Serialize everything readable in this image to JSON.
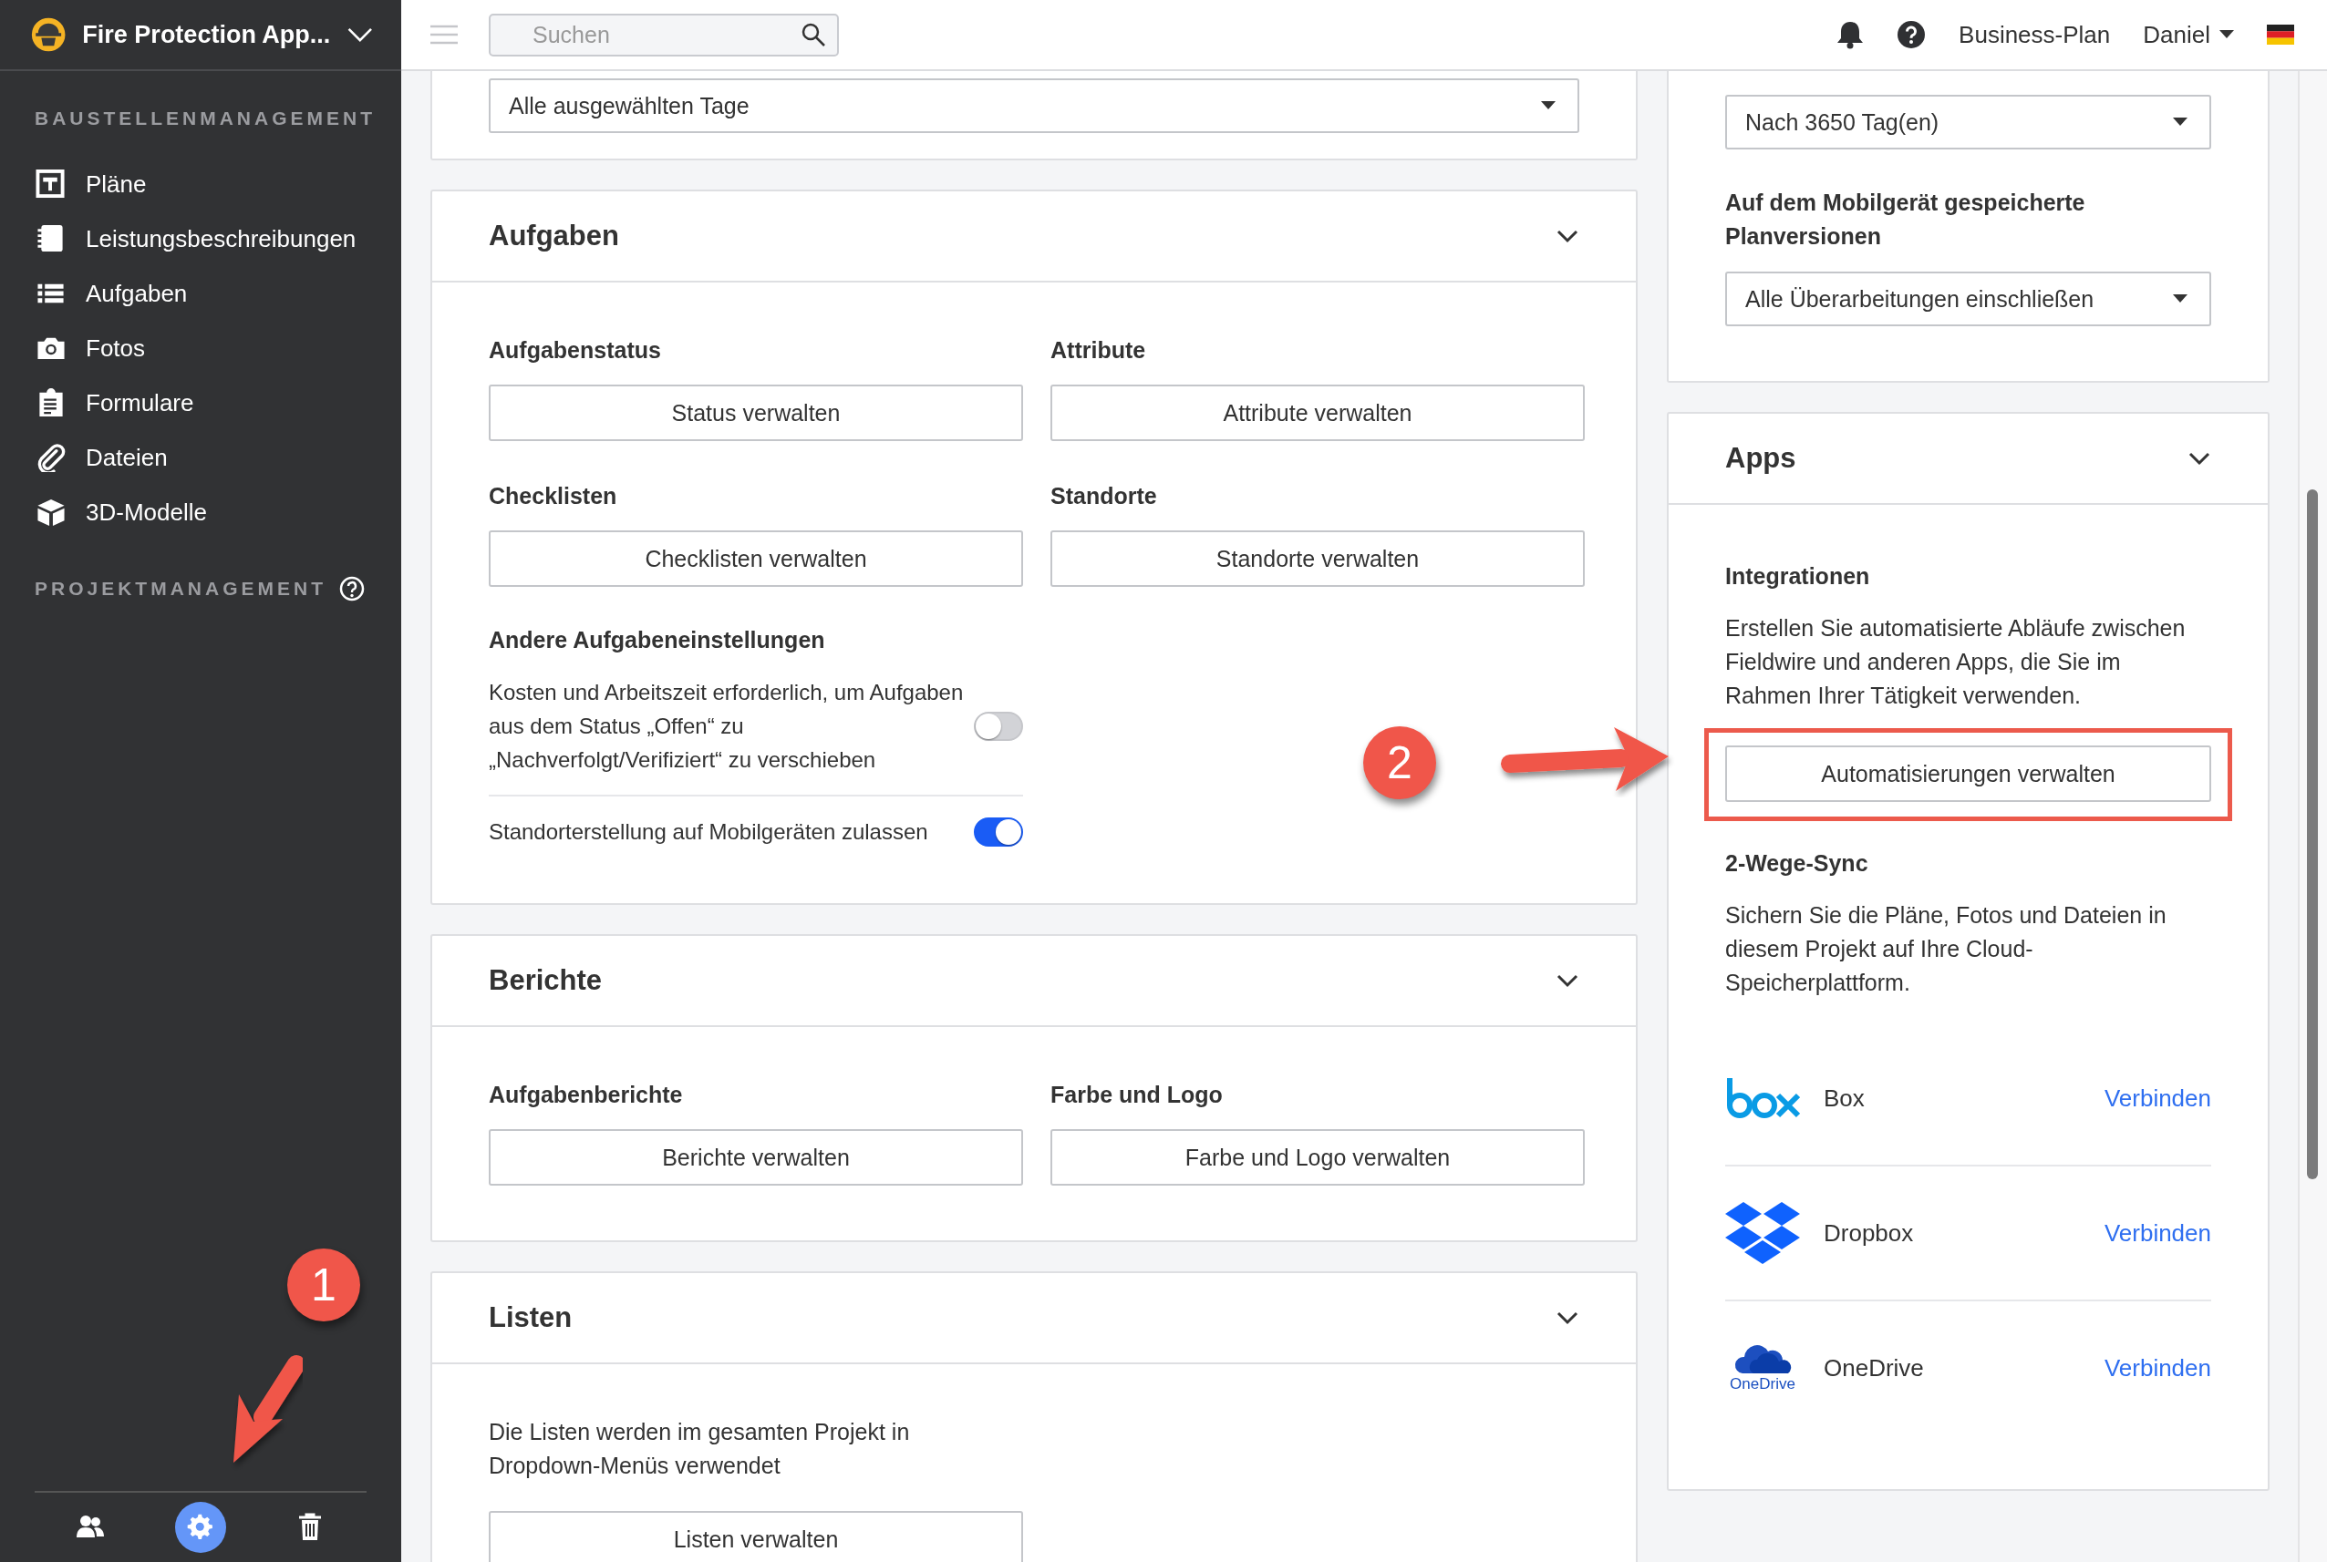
{
  "sidebar": {
    "project_title": "Fire Protection App...",
    "sections": [
      {
        "heading": "BAUSTELLENMANAGEMENT",
        "items": [
          {
            "label": "Pläne",
            "kind": "plans"
          },
          {
            "label": "Leistungsbeschreibungen",
            "kind": "specs"
          },
          {
            "label": "Aufgaben",
            "kind": "tasks"
          },
          {
            "label": "Fotos",
            "kind": "photos"
          },
          {
            "label": "Formulare",
            "kind": "forms"
          },
          {
            "label": "Dateien",
            "kind": "files"
          },
          {
            "label": "3D-Modelle",
            "kind": "models"
          }
        ]
      },
      {
        "heading": "PROJEKTMANAGEMENT",
        "help": true
      }
    ],
    "footer": [
      {
        "kind": "people",
        "selected": false
      },
      {
        "kind": "settings",
        "selected": true
      },
      {
        "kind": "trash",
        "selected": false
      }
    ]
  },
  "topbar": {
    "search": {
      "placeholder": "Suchen"
    },
    "plan": "Business-Plan",
    "user": "Daniel"
  },
  "columns": [
    {
      "cards": [
        {
          "blocks": [
            {
              "kind": "select",
              "value": "Alle ausgewählten Tage"
            }
          ]
        },
        {
          "title": "Aufgaben",
          "expanded": true,
          "blocks": [
            {
              "kind": "grid",
              "items": [
                {
                  "label": "Aufgabenstatus",
                  "button": "Status verwalten"
                },
                {
                  "label": "Attribute",
                  "button": "Attribute verwalten"
                },
                {
                  "label": "Checklisten",
                  "button": "Checklisten verwalten"
                },
                {
                  "label": "Standorte",
                  "button": "Standorte verwalten"
                }
              ]
            },
            {
              "kind": "heading",
              "text": "Andere Aufgabeneinstellungen"
            },
            {
              "kind": "toggle",
              "text": "Kosten und Arbeitszeit erforderlich, um Aufgaben aus dem Status „Offen“ zu „Nachverfolgt/Verifiziert“ zu verschieben",
              "on": false
            },
            {
              "kind": "toggle",
              "text": "Standorterstellung auf Mobilgeräten zulassen",
              "on": true
            }
          ]
        },
        {
          "title": "Berichte",
          "expanded": true,
          "blocks": [
            {
              "kind": "grid",
              "items": [
                {
                  "label": "Aufgabenberichte",
                  "button": "Berichte verwalten"
                },
                {
                  "label": "Farbe und Logo",
                  "button": "Farbe und Logo verwalten"
                }
              ]
            }
          ]
        },
        {
          "title": "Listen",
          "expanded": true,
          "blocks": [
            {
              "kind": "text",
              "text": "Die Listen werden im gesamten Projekt in Dropdown-Menüs verwendet"
            },
            {
              "kind": "button",
              "label": "Listen verwalten"
            }
          ]
        }
      ]
    },
    {
      "cards": [
        {
          "blocks": [
            {
              "kind": "select",
              "value": "Nach 3650 Tag(en)"
            },
            {
              "kind": "heading",
              "text": "Auf dem Mobilgerät gespeicherte Planversionen"
            },
            {
              "kind": "select",
              "value": "Alle Überarbeitungen einschließen"
            }
          ]
        },
        {
          "title": "Apps",
          "expanded": true,
          "blocks": [
            {
              "kind": "heading",
              "text": "Integrationen"
            },
            {
              "kind": "text",
              "text": "Erstellen Sie automatisierte Abläufe zwischen Fieldwire und anderen Apps, die Sie im Rahmen Ihrer Tätigkeit verwenden."
            },
            {
              "kind": "button",
              "label": "Automatisierungen verwalten",
              "highlighted": true
            },
            {
              "kind": "heading",
              "text": "2-Wege-Sync"
            },
            {
              "kind": "text",
              "text": "Sichern Sie die Pläne, Fotos und Dateien in diesem Projekt auf Ihre Cloud-Speicherplattform."
            },
            {
              "kind": "integrations",
              "items": [
                {
                  "name": "Box",
                  "kind": "box",
                  "action": "Verbinden"
                },
                {
                  "name": "Dropbox",
                  "kind": "dropbox",
                  "action": "Verbinden"
                },
                {
                  "name": "OneDrive",
                  "kind": "onedrive",
                  "logo_text": "OneDrive",
                  "action": "Verbinden"
                }
              ]
            }
          ]
        }
      ]
    }
  ],
  "annotations": [
    {
      "label": "1"
    },
    {
      "label": "2"
    }
  ]
}
